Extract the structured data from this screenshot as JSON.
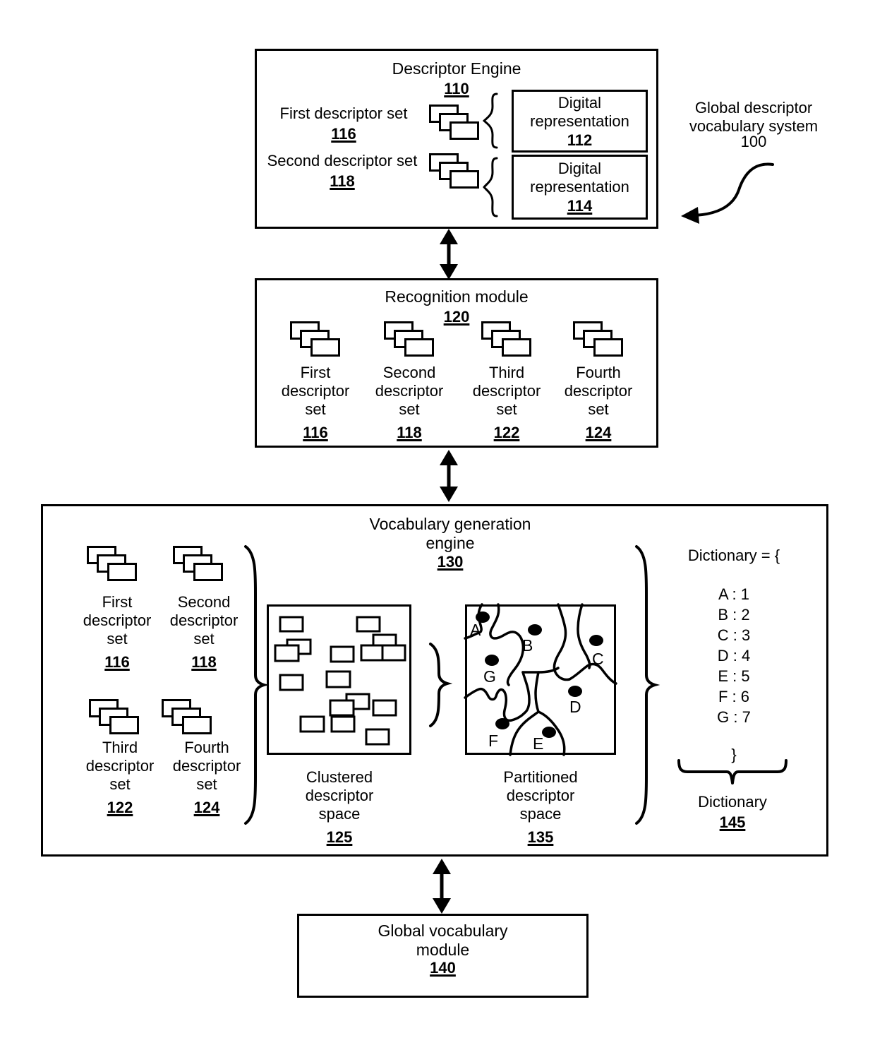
{
  "figure": {
    "system_label": "Global descriptor\nvocabulary system",
    "system_number": "100"
  },
  "descriptor_engine": {
    "title": "Descriptor Engine",
    "number": "110",
    "first_set_label": "First descriptor set",
    "first_set_number": "116",
    "second_set_label": "Second descriptor set",
    "second_set_number": "118",
    "digital_rep_1_label": "Digital\nrepresentation",
    "digital_rep_1_number": "112",
    "digital_rep_2_label": "Digital\nrepresentation",
    "digital_rep_2_number": "114"
  },
  "recognition_module": {
    "title": "Recognition module",
    "number": "120",
    "sets": [
      {
        "label": "First\ndescriptor\nset",
        "number": "116"
      },
      {
        "label": "Second\ndescriptor\nset",
        "number": "118"
      },
      {
        "label": "Third\ndescriptor\nset",
        "number": "122"
      },
      {
        "label": "Fourth\ndescriptor\nset",
        "number": "124"
      }
    ]
  },
  "vocabulary_generation_engine": {
    "title": "Vocabulary generation\nengine",
    "number": "130",
    "sets": [
      {
        "label": "First\ndescriptor\nset",
        "number": "116"
      },
      {
        "label": "Second\ndescriptor\nset",
        "number": "118"
      },
      {
        "label": "Third\ndescriptor\nset",
        "number": "122"
      },
      {
        "label": "Fourth\ndescriptor\nset",
        "number": "124"
      }
    ],
    "clustered_space": {
      "label": "Clustered\ndescriptor\nspace",
      "number": "125"
    },
    "partitioned_space": {
      "label": "Partitioned\ndescriptor\nspace",
      "number": "135",
      "region_labels": [
        "A",
        "B",
        "C",
        "D",
        "E",
        "F",
        "G"
      ]
    },
    "dictionary": {
      "open_text": "Dictionary = {",
      "entries": [
        "A : 1",
        "B : 2",
        "C : 3",
        "D : 4",
        "E : 5",
        "F : 6",
        "G : 7"
      ],
      "close_text": "}",
      "caption": "Dictionary",
      "number": "145"
    }
  },
  "global_vocabulary_module": {
    "title": "Global vocabulary\nmodule",
    "number": "140"
  },
  "colors": {
    "stroke": "#000000",
    "background": "#ffffff"
  }
}
